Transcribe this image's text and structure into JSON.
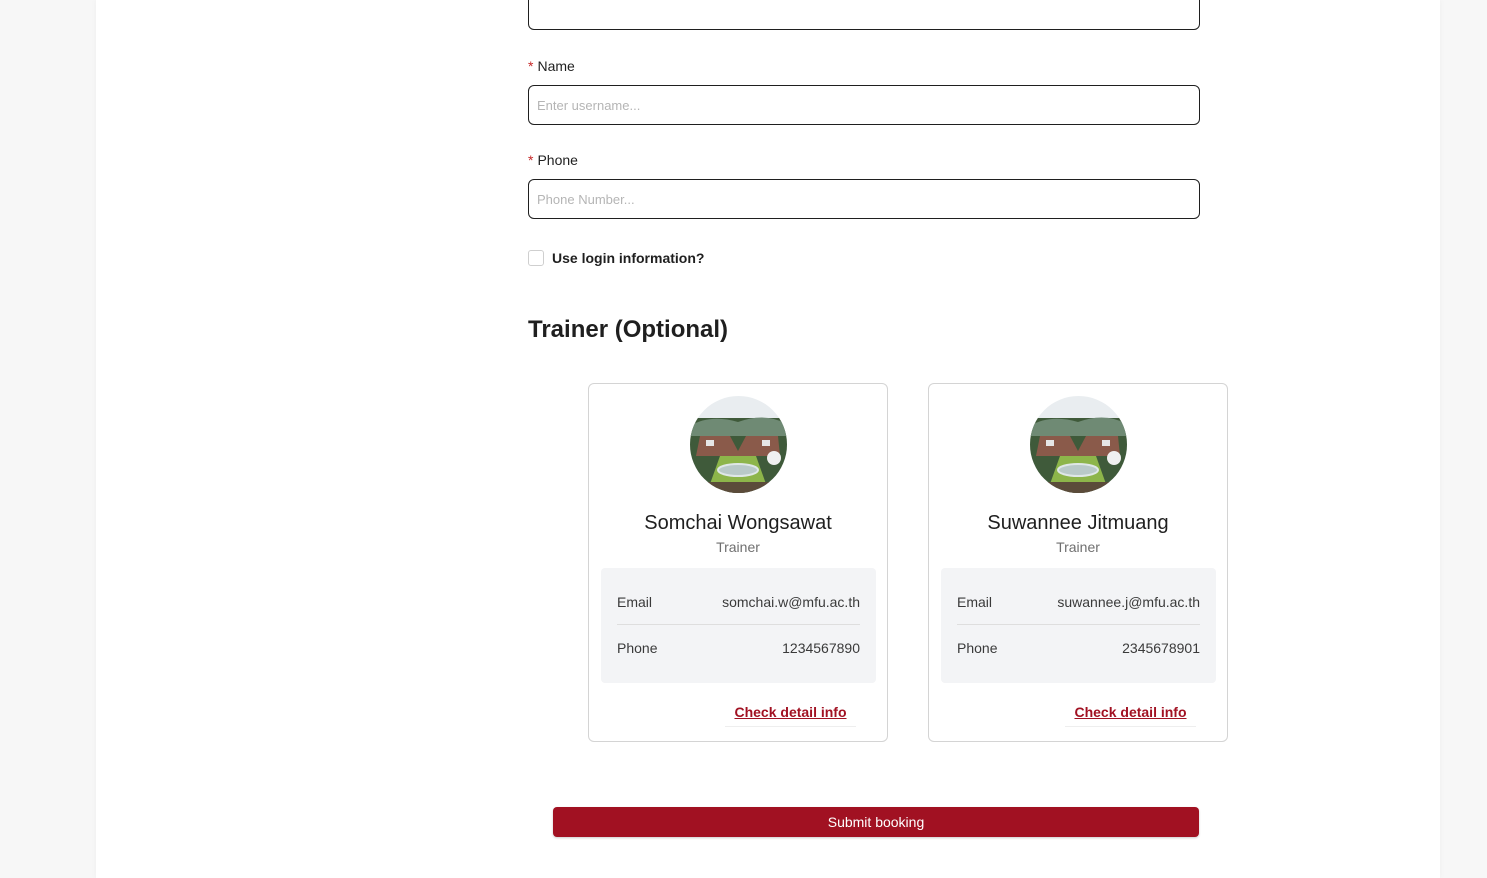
{
  "form": {
    "name_label": "Name",
    "name_placeholder": "Enter username...",
    "phone_label": "Phone",
    "phone_placeholder": "Phone Number...",
    "required_mark": "*",
    "use_login_label": "Use login information?"
  },
  "trainer_section": {
    "title": "Trainer (Optional)",
    "cards": [
      {
        "name": "Somchai Wongsawat",
        "role": "Trainer",
        "email_label": "Email",
        "email": "somchai.w@mfu.ac.th",
        "phone_label": "Phone",
        "phone": "1234567890",
        "link_label": "Check detail info"
      },
      {
        "name": "Suwannee Jitmuang",
        "role": "Trainer",
        "email_label": "Email",
        "email": "suwannee.j@mfu.ac.th",
        "phone_label": "Phone",
        "phone": "2345678901",
        "link_label": "Check detail info"
      }
    ]
  },
  "submit": {
    "label": "Submit booking"
  },
  "colors": {
    "accent": "#a11122",
    "required": "#c62828",
    "info_bg": "#f3f4f6"
  },
  "icons": {
    "avatar": "campus-aerial-photo"
  }
}
